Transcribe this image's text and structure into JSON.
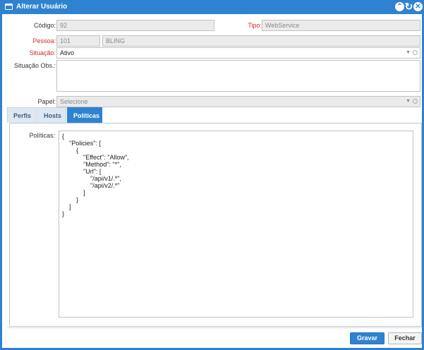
{
  "window": {
    "title": "Alterar Usuário"
  },
  "form": {
    "codigo": {
      "label": "Código:",
      "value": "92"
    },
    "tipo": {
      "label": "Tipo:",
      "value": "WebService"
    },
    "pessoa": {
      "label": "Pessoa:",
      "id_value": "101",
      "name_value": "BLING"
    },
    "situacao": {
      "label": "Situação:",
      "value": "Ativo"
    },
    "situacao_obs": {
      "label": "Situação Obs.:",
      "value": ""
    },
    "papel": {
      "label": "Papel:",
      "placeholder": "Selecione"
    }
  },
  "tabs": [
    {
      "label": "Perfis"
    },
    {
      "label": "Hosts"
    },
    {
      "label": "Políticas"
    }
  ],
  "politicas": {
    "label": "Políticas:",
    "value": "{\n    \"Policies\": [\n        {\n            \"Effect\": \"Allow\",\n            \"Method\": \"*\",\n            \"Url\": [\n                \"/api/v1/.*\",\n                \"/api/v2/.*\"\n            ]\n        }\n    ]\n}"
  },
  "buttons": {
    "save": "Gravar",
    "close": "Fechar"
  },
  "colors": {
    "accent": "#2f82d0",
    "required_label": "#d42626"
  }
}
